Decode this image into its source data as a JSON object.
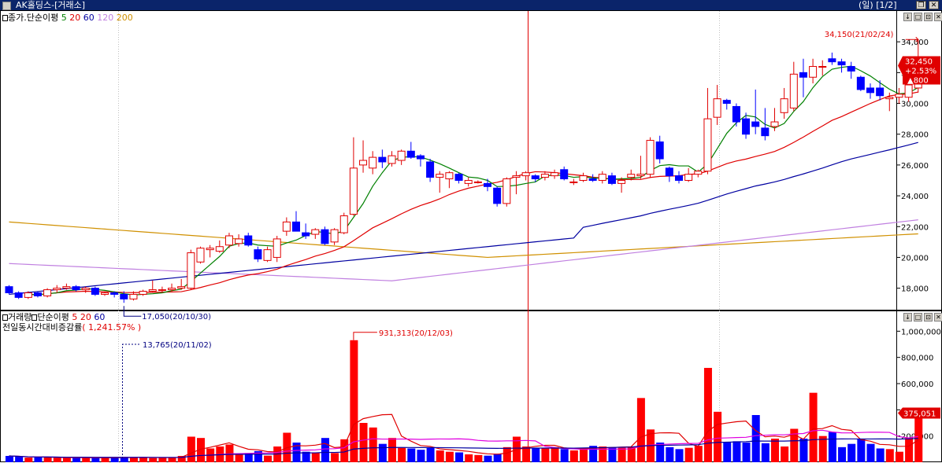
{
  "window": {
    "title": "AK홀딩스-[거래소]",
    "period": "(일)",
    "page": "[1/2]",
    "buttons": [
      "restore-icon",
      "close-icon"
    ]
  },
  "price_legend": {
    "label": "종가.단순이평",
    "periods": [
      {
        "text": "5",
        "color": "#008000"
      },
      {
        "text": "20",
        "color": "#e00000"
      },
      {
        "text": "60",
        "color": "#0000a0"
      },
      {
        "text": "120",
        "color": "#c080e0"
      },
      {
        "text": "200",
        "color": "#d09000"
      }
    ]
  },
  "volume_legend": {
    "label1": "거래량",
    "label2": "단순이평",
    "periods": [
      {
        "text": "5",
        "color": "#e00000"
      },
      {
        "text": "20",
        "color": "#e00000"
      },
      {
        "text": "60",
        "color": "#0000a0"
      }
    ],
    "ratio_label": "전일동시간대비증감률",
    "ratio_value": "( 1,241.57% )"
  },
  "chart_data": [
    {
      "type": "candlestick",
      "panel": "price",
      "ylim": [
        16500,
        36000
      ],
      "y_ticks": [
        "18,000",
        "20,000",
        "22,000",
        "24,000",
        "26,000",
        "28,000",
        "30,000",
        "32,000",
        "34,000"
      ],
      "y_tick_values": [
        18000,
        20000,
        22000,
        24000,
        26000,
        28000,
        30000,
        32000,
        34000
      ],
      "grid": "vertical dotted at month starts",
      "candles": [
        [
          18100,
          18200,
          17600,
          17700
        ],
        [
          17700,
          17800,
          17300,
          17400
        ],
        [
          17400,
          17800,
          17300,
          17700
        ],
        [
          17700,
          17800,
          17400,
          17500
        ],
        [
          17500,
          18000,
          17400,
          17900
        ],
        [
          17900,
          18200,
          17700,
          18000
        ],
        [
          18000,
          18300,
          17900,
          18100
        ],
        [
          18100,
          18200,
          17800,
          17900
        ],
        [
          17900,
          18100,
          17700,
          18000
        ],
        [
          18000,
          18100,
          17500,
          17600
        ],
        [
          17600,
          17800,
          17500,
          17700
        ],
        [
          17700,
          17800,
          17400,
          17600
        ],
        [
          17600,
          17800,
          17050,
          17300
        ],
        [
          17300,
          17800,
          17200,
          17600
        ],
        [
          17600,
          17900,
          17500,
          17800
        ],
        [
          17800,
          18500,
          17700,
          17900
        ],
        [
          17900,
          18100,
          17700,
          17900
        ],
        [
          17900,
          18300,
          17800,
          18000
        ],
        [
          18000,
          18600,
          17900,
          18100
        ],
        [
          18000,
          20500,
          17900,
          20300
        ],
        [
          19700,
          20700,
          19600,
          20600
        ],
        [
          20500,
          20800,
          20000,
          20600
        ],
        [
          20400,
          21100,
          20300,
          20700
        ],
        [
          20800,
          21600,
          20600,
          21400
        ],
        [
          20900,
          21500,
          20700,
          21200
        ],
        [
          21400,
          21600,
          20700,
          20800
        ],
        [
          20500,
          20700,
          19700,
          19900
        ],
        [
          19800,
          20700,
          19700,
          20500
        ],
        [
          20000,
          21400,
          19700,
          21200
        ],
        [
          21700,
          22600,
          21400,
          22300
        ],
        [
          22300,
          23000,
          21800,
          21700
        ],
        [
          21600,
          22200,
          21200,
          21400
        ],
        [
          21500,
          21900,
          21200,
          21800
        ],
        [
          21800,
          22000,
          20800,
          20900
        ],
        [
          21000,
          21900,
          20800,
          21800
        ],
        [
          21600,
          22900,
          21500,
          22700
        ],
        [
          22800,
          27800,
          22700,
          25800
        ],
        [
          26000,
          27600,
          25500,
          26300
        ],
        [
          25800,
          26900,
          25400,
          26500
        ],
        [
          26500,
          27000,
          25800,
          26200
        ],
        [
          26100,
          26900,
          25900,
          26600
        ],
        [
          26300,
          27000,
          26000,
          26900
        ],
        [
          26900,
          27500,
          26400,
          26500
        ],
        [
          26600,
          26700,
          25900,
          26400
        ],
        [
          26200,
          26400,
          24900,
          25200
        ],
        [
          25200,
          25600,
          24200,
          25400
        ],
        [
          25100,
          25600,
          24500,
          25500
        ],
        [
          25400,
          25500,
          24800,
          25000
        ],
        [
          24800,
          25200,
          24600,
          25000
        ],
        [
          24900,
          25000,
          24800,
          24900
        ],
        [
          24800,
          25100,
          24300,
          24600
        ],
        [
          24500,
          24600,
          23300,
          23500
        ],
        [
          23500,
          25200,
          23300,
          25100
        ],
        [
          25200,
          25600,
          24100,
          25300
        ],
        [
          25300,
          25600,
          25000,
          25500
        ],
        [
          25300,
          25400,
          24900,
          25100
        ],
        [
          25200,
          25600,
          25000,
          25400
        ],
        [
          25300,
          25700,
          25100,
          25500
        ],
        [
          25700,
          25900,
          25000,
          25100
        ],
        [
          24900,
          25100,
          24700,
          24900
        ],
        [
          25000,
          25500,
          24900,
          25300
        ],
        [
          25100,
          25400,
          24900,
          25000
        ],
        [
          25000,
          25600,
          24800,
          25400
        ],
        [
          25300,
          25500,
          24700,
          24800
        ],
        [
          24800,
          25200,
          24200,
          25000
        ],
        [
          25200,
          25700,
          25000,
          25400
        ],
        [
          25300,
          26600,
          25100,
          25400
        ],
        [
          25400,
          27800,
          25200,
          27600
        ],
        [
          27500,
          27900,
          26100,
          26400
        ],
        [
          25800,
          25900,
          24900,
          25300
        ],
        [
          25300,
          25600,
          24800,
          25000
        ],
        [
          25000,
          25800,
          24900,
          25400
        ],
        [
          25400,
          25700,
          25200,
          25600
        ],
        [
          25600,
          31000,
          25400,
          29000
        ],
        [
          29100,
          31200,
          28600,
          30300
        ],
        [
          30200,
          30300,
          29600,
          30000
        ],
        [
          29800,
          30000,
          28500,
          28800
        ],
        [
          29000,
          29400,
          27700,
          28000
        ],
        [
          28800,
          30900,
          28000,
          28500
        ],
        [
          28400,
          29700,
          27600,
          27900
        ],
        [
          28500,
          29700,
          28200,
          28800
        ],
        [
          29400,
          31000,
          29000,
          30300
        ],
        [
          29700,
          32700,
          29500,
          31900
        ],
        [
          32000,
          32900,
          30400,
          31700
        ],
        [
          31700,
          32900,
          31300,
          32400
        ],
        [
          32400,
          32800,
          31800,
          32400
        ],
        [
          32900,
          33300,
          32500,
          32700
        ],
        [
          32700,
          32900,
          32000,
          32500
        ],
        [
          32400,
          32700,
          31600,
          32100
        ],
        [
          31700,
          31800,
          30800,
          30900
        ],
        [
          31000,
          31300,
          30300,
          30700
        ],
        [
          31000,
          31500,
          30200,
          30500
        ],
        [
          30300,
          30700,
          29500,
          30400
        ],
        [
          30400,
          31000,
          30000,
          30600
        ],
        [
          30400,
          31200,
          30100,
          31200
        ],
        [
          31000,
          34150,
          30700,
          32450
        ]
      ],
      "ma_values_last": {
        "ma5": "green",
        "ma20": "red",
        "ma60": "navy",
        "ma120": "violet",
        "ma200": "orange"
      },
      "annotations": [
        {
          "text": "34,150(21/02/24)",
          "color": "#e00000"
        },
        {
          "text": "17,050(20/10/30)",
          "color": "#000080"
        }
      ],
      "current": {
        "price": "32,450",
        "change_pct": "+2.53%",
        "change": "▲800"
      }
    },
    {
      "type": "bar",
      "panel": "volume",
      "ylim": [
        0,
        1080000
      ],
      "y_ticks": [
        "200,000",
        "400,000",
        "600,000",
        "800,000",
        "1,000,000"
      ],
      "y_tick_values": [
        200000,
        400000,
        600000,
        800000,
        1000000
      ],
      "values": [
        48000,
        42000,
        35000,
        36000,
        38000,
        34000,
        33000,
        36000,
        35000,
        33000,
        34000,
        35000,
        40000,
        36000,
        37000,
        32000,
        33000,
        36000,
        48000,
        195000,
        185000,
        105000,
        120000,
        135000,
        65000,
        70000,
        85000,
        50000,
        120000,
        225000,
        150000,
        80000,
        75000,
        185000,
        70000,
        175000,
        931313,
        300000,
        265000,
        140000,
        185000,
        110000,
        105000,
        95000,
        110000,
        90000,
        80000,
        75000,
        60000,
        55000,
        50000,
        65000,
        115000,
        195000,
        120000,
        110000,
        105000,
        115000,
        100000,
        90000,
        110000,
        125000,
        120000,
        115000,
        110000,
        120000,
        490000,
        250000,
        150000,
        115000,
        100000,
        110000,
        125000,
        720000,
        385000,
        155000,
        160000,
        150000,
        360000,
        145000,
        180000,
        120000,
        255000,
        180000,
        530000,
        200000,
        230000,
        115000,
        140000,
        180000,
        140000,
        105000,
        100000,
        80000,
        185000,
        375051
      ],
      "colors": "red=up day, blue=down day",
      "annotations": [
        {
          "text": "931,313(20/12/03)",
          "color": "#e00000"
        },
        {
          "text": "13,765(20/11/02)",
          "color": "#000080"
        }
      ],
      "current": "375,051"
    }
  ]
}
